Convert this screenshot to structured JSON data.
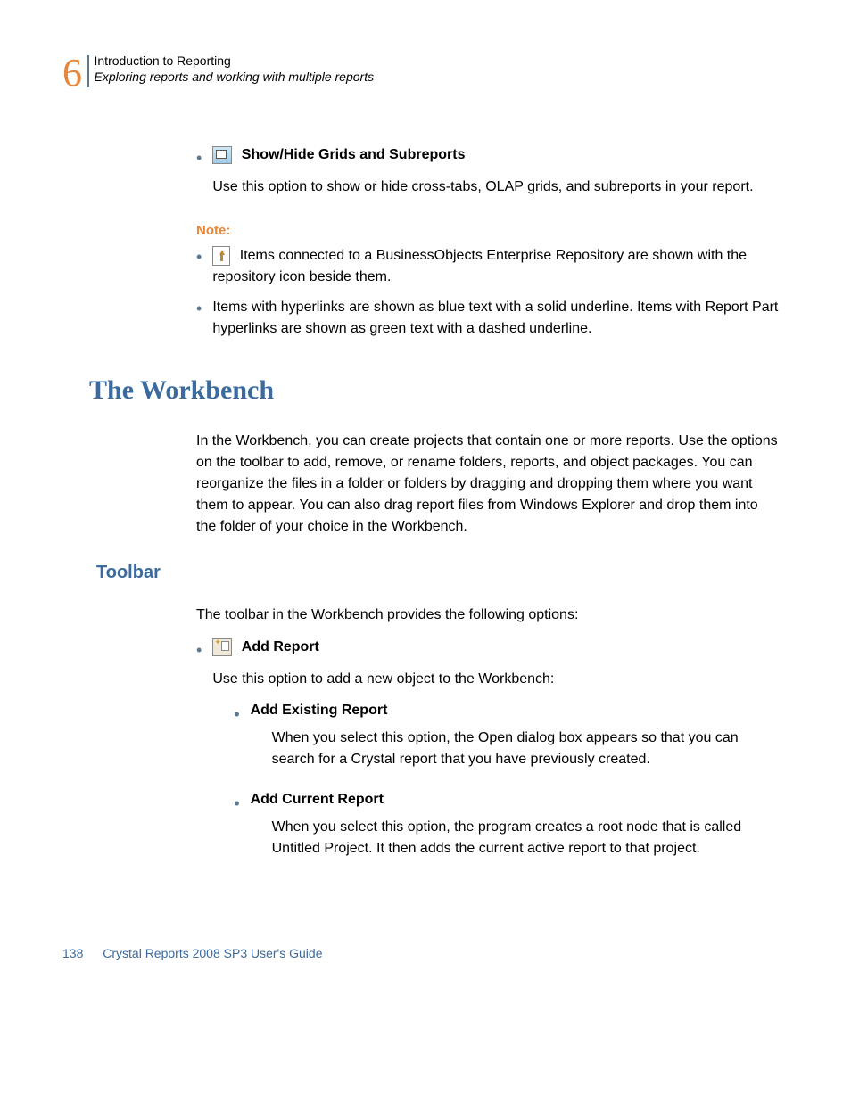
{
  "header": {
    "chapter_number": "6",
    "title": "Introduction to Reporting",
    "subtitle": "Exploring reports and working with multiple reports"
  },
  "options": {
    "showhide": {
      "heading": "Show/Hide Grids and Subreports",
      "desc": "Use this option to show or hide cross-tabs, OLAP grids, and subreports in your report."
    }
  },
  "note": {
    "label": "Note:",
    "items": [
      " Items connected to a BusinessObjects Enterprise Repository are shown with the repository icon beside them.",
      "Items with hyperlinks are shown as blue text with a solid underline. Items with Report Part hyperlinks are shown as green text with a dashed underline."
    ]
  },
  "workbench": {
    "heading": "The Workbench",
    "desc": "In the Workbench, you can create projects that contain one or more reports. Use the options on the toolbar to add, remove, or rename folders, reports, and object packages. You can reorganize the files in a folder or folders by dragging and dropping them where you want them to appear. You can also drag report files from Windows Explorer and drop them into the folder of your choice in the Workbench."
  },
  "toolbar": {
    "heading": "Toolbar",
    "intro": "The toolbar in the Workbench provides the following options:",
    "add_report": {
      "heading": "Add Report",
      "desc": "Use this option to add a new object to the Workbench:",
      "sub": [
        {
          "title": "Add Existing Report",
          "desc": "When you select this option, the Open dialog box appears so that you can search for a Crystal report that you have previously created."
        },
        {
          "title": "Add Current Report",
          "desc": "When you select this option, the program creates a root node that is called Untitled Project. It then adds the current active report to that project."
        }
      ]
    }
  },
  "footer": {
    "page": "138",
    "title": "Crystal Reports 2008 SP3 User's Guide"
  }
}
